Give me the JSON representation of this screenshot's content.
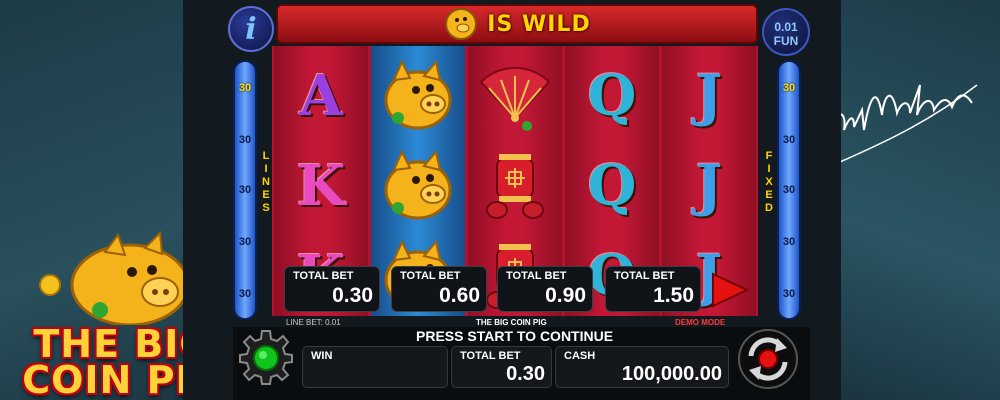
{
  "banner": {
    "text": "IS WILD"
  },
  "info_button": {
    "label": "i"
  },
  "denomination": {
    "amount": "0.01",
    "currency": "FUN"
  },
  "lines_panel": {
    "left_label": "LINES",
    "right_label": "FIXED",
    "line_numbers": [
      "30",
      "30",
      "30",
      "30",
      "30"
    ]
  },
  "reels": [
    [
      "A",
      "K",
      "K"
    ],
    [
      "pig",
      "pig",
      "pig"
    ],
    [
      "fan",
      "lantern",
      "lantern"
    ],
    [
      "Q",
      "Q",
      "Q"
    ],
    [
      "J",
      "J",
      "J"
    ]
  ],
  "bet_options": [
    {
      "label": "TOTAL BET",
      "value": "0.30"
    },
    {
      "label": "TOTAL BET",
      "value": "0.60"
    },
    {
      "label": "TOTAL BET",
      "value": "0.90"
    },
    {
      "label": "TOTAL BET",
      "value": "1.50"
    }
  ],
  "info_strip": {
    "line_bet": "LINE BET: 0.01",
    "game_name": "THE BIG COIN PIG",
    "mode": "DEMO MODE"
  },
  "status": {
    "message": "PRESS START TO CONTINUE"
  },
  "win": {
    "label": "WIN",
    "value": ""
  },
  "total_bet": {
    "label": "TOTAL BET",
    "value": "0.30"
  },
  "cash": {
    "label": "CASH",
    "value": "100,000.00"
  },
  "logo": {
    "line1": "THE BIG",
    "line2": "COIN PIG"
  },
  "signature": {
    "text": "JanMartens"
  },
  "icons": {
    "info": "info-icon",
    "settings": "gear-icon",
    "play": "play-triangle-icon",
    "autoplay": "refresh-arrows-icon",
    "wild": "pig-coin-icon"
  },
  "colors": {
    "accent_red": "#c31736",
    "gold": "#ffd400",
    "line_bar_blue": "#3c7ee8",
    "settings_green": "#10c41b",
    "play_red": "#e51212"
  }
}
